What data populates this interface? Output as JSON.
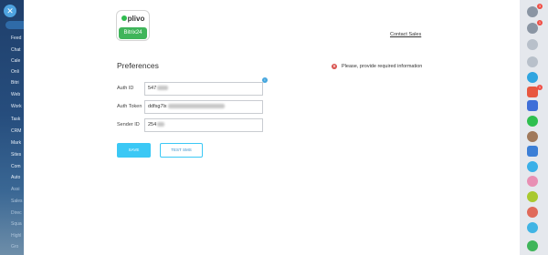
{
  "sidebar": {
    "items": [
      {
        "label": "Feed"
      },
      {
        "label": "Chat"
      },
      {
        "label": "Cale"
      },
      {
        "label": "Onli"
      },
      {
        "label": "Bitri"
      },
      {
        "label": "Web"
      },
      {
        "label": "Work"
      },
      {
        "label": "Task"
      },
      {
        "label": "CRM"
      },
      {
        "label": "Mark"
      },
      {
        "label": "Sites"
      },
      {
        "label": "Com"
      },
      {
        "label": "Auto"
      },
      {
        "label": "Assi"
      },
      {
        "label": "Sales"
      },
      {
        "label": "Direc"
      },
      {
        "label": "Squa"
      },
      {
        "label": "Highl"
      },
      {
        "label": "Gro"
      }
    ]
  },
  "app": {
    "logo_brand": "plivo",
    "logo_subtitle": "Bitrix24"
  },
  "header": {
    "contact_sales": "Contact Sales"
  },
  "preferences": {
    "title": "Preferences",
    "error_message": "Please, provide required information",
    "fields": {
      "auth_id": {
        "label": "Auth ID",
        "value": "547"
      },
      "auth_token": {
        "label": "Auth Token",
        "value": "ddfsg7lx"
      },
      "sender_id": {
        "label": "Sender ID",
        "value": "254"
      }
    }
  },
  "buttons": {
    "save": "SAVE",
    "test_sms": "TEST SMS"
  },
  "rightbar": {
    "badges": [
      "3",
      "1",
      "1"
    ],
    "icons": [
      "help-icon",
      "bell-icon",
      "gear-icon",
      "search-icon",
      "phone-icon",
      "stack-icon",
      "calendar-icon",
      "whatsapp-icon",
      "user-avatar-icon",
      "chat-icon",
      "contact-icon",
      "contact-icon",
      "contact-icon",
      "contact-icon",
      "contact-icon",
      "phone-call-icon"
    ]
  },
  "colors": {
    "accent": "#3bc8f5",
    "error": "#d9534f",
    "brand_green": "#3fb55a",
    "sidebar": "#1f3f6b"
  }
}
